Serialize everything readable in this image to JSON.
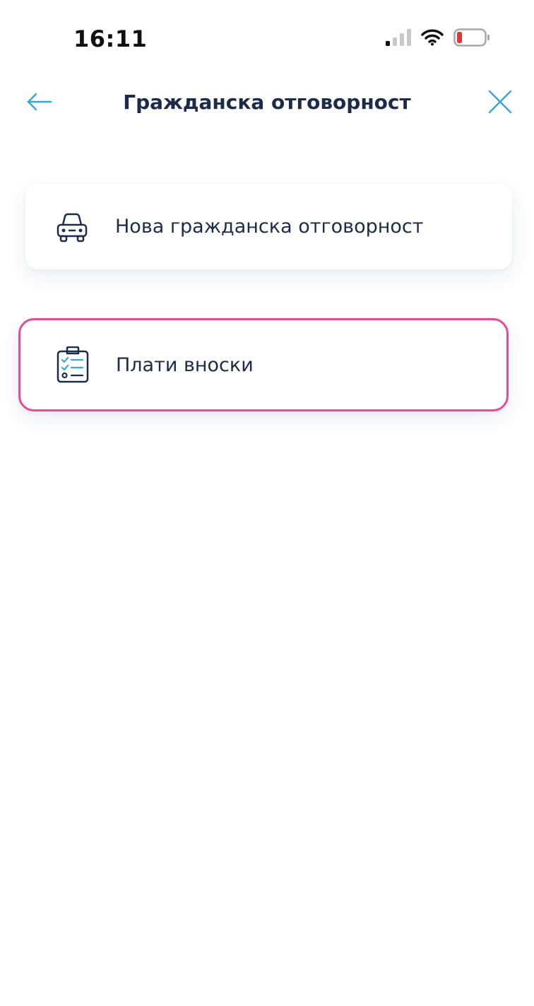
{
  "status_bar": {
    "time": "16:11",
    "icons": [
      "cellular-signal-icon",
      "wifi-icon",
      "battery-low-icon"
    ]
  },
  "header": {
    "title": "Гражданска отговорност",
    "back_icon": "arrow-left-icon",
    "close_icon": "close-icon"
  },
  "menu": {
    "items": [
      {
        "label": "Нова гражданска отговорност",
        "icon": "car-icon"
      },
      {
        "label": "Плати вноски",
        "icon": "clipboard-checklist-icon"
      }
    ]
  },
  "colors": {
    "text": "#1b2b48",
    "accent": "#3aa7d8",
    "highlight_border": "#e84a9a",
    "battery_low": "#e8352f"
  }
}
